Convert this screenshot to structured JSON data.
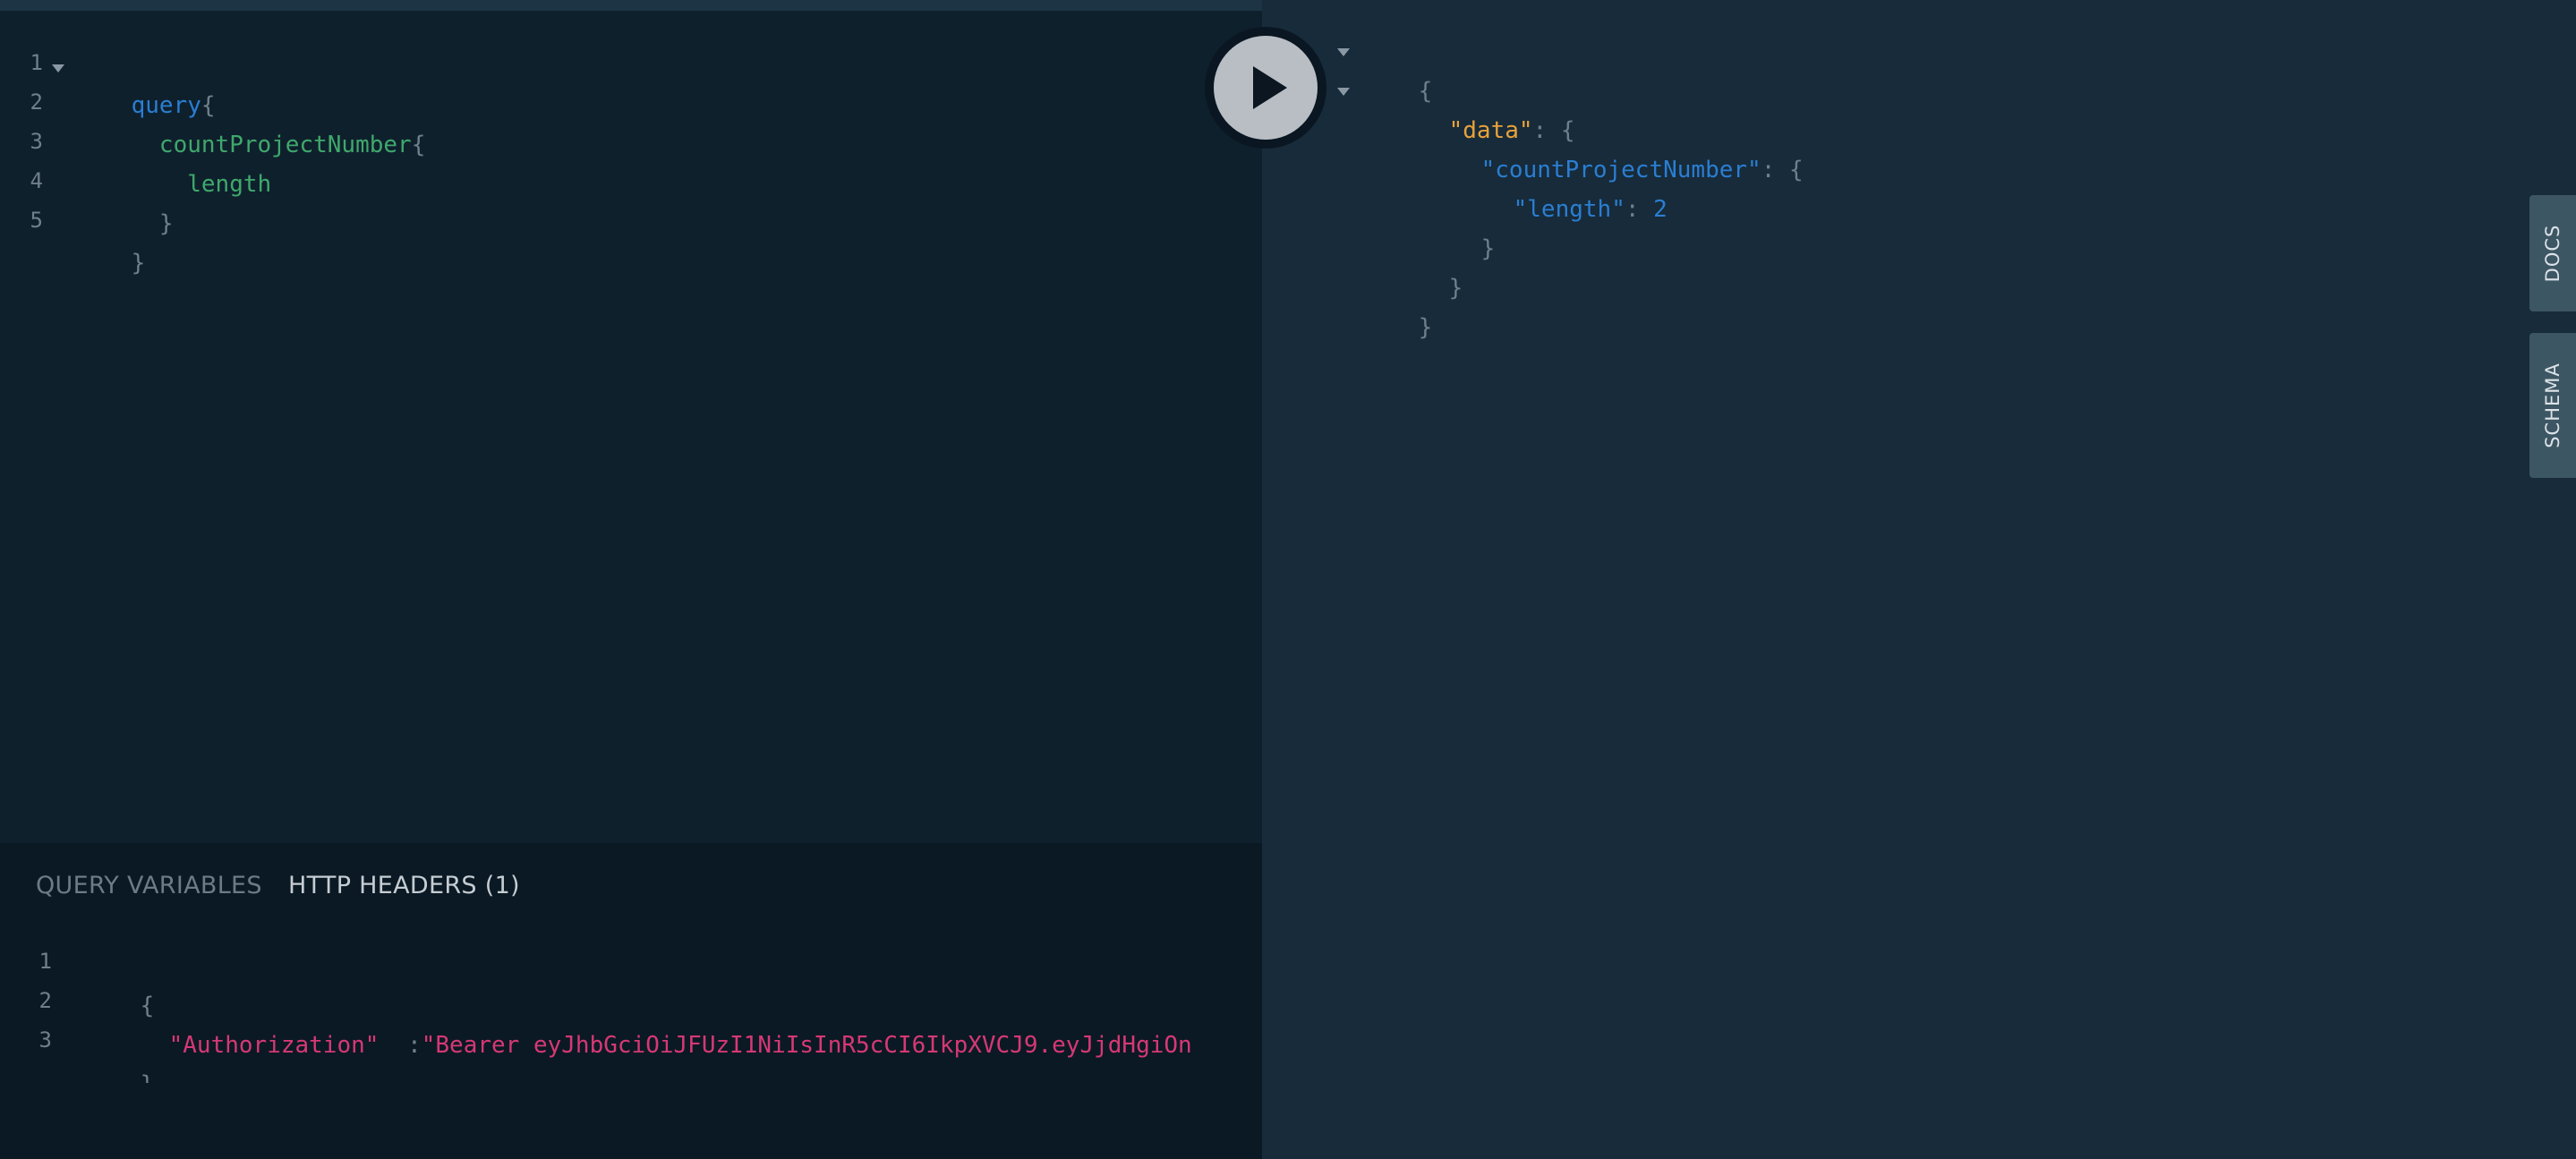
{
  "query_editor": {
    "line_numbers": [
      "1",
      "2",
      "3",
      "4",
      "5"
    ],
    "lines": [
      {
        "tokens": [
          {
            "t": "query",
            "c": "kw"
          },
          {
            "t": "{",
            "c": "punc"
          }
        ]
      },
      {
        "tokens": [
          {
            "t": "  countProjectNumber",
            "c": "field"
          },
          {
            "t": "{",
            "c": "punc"
          }
        ]
      },
      {
        "tokens": [
          {
            "t": "    length",
            "c": "field"
          }
        ]
      },
      {
        "tokens": [
          {
            "t": "  }",
            "c": "punc"
          }
        ]
      },
      {
        "tokens": [
          {
            "t": "}",
            "c": "punc"
          }
        ]
      }
    ]
  },
  "execute_button": {
    "icon": "play-icon"
  },
  "variables_panel": {
    "tabs": [
      {
        "label": "QUERY VARIABLES",
        "active": false
      },
      {
        "label": "HTTP HEADERS (1)",
        "active": true
      }
    ],
    "line_numbers": [
      "1",
      "2",
      "3"
    ],
    "line1": "{",
    "line2_key": "\"Authorization\"",
    "line2_sep": " :",
    "line2_value": "\"Bearer eyJhbGciOiJFUzI1NiIsInR5cCI6IkpXVCJ9.eyJjdHgiOn",
    "line3": "}"
  },
  "result": {
    "l1": "{",
    "l2_key": "\"data\"",
    "l2_rest": ": {",
    "l3_key": "\"countProjectNumber\"",
    "l3_rest": ": {",
    "l4_key": "\"length\"",
    "l4_sep": ": ",
    "l4_value": "2",
    "l5": "}",
    "l6": "}",
    "l7": "}"
  },
  "side_tabs": {
    "docs": "DOCS",
    "schema": "SCHEMA"
  },
  "colors": {
    "keyword": "#2a7ed2",
    "field": "#3fa86b",
    "header_string": "#d63875",
    "result_data_key": "#e8a23a",
    "background": "#172b3a"
  }
}
